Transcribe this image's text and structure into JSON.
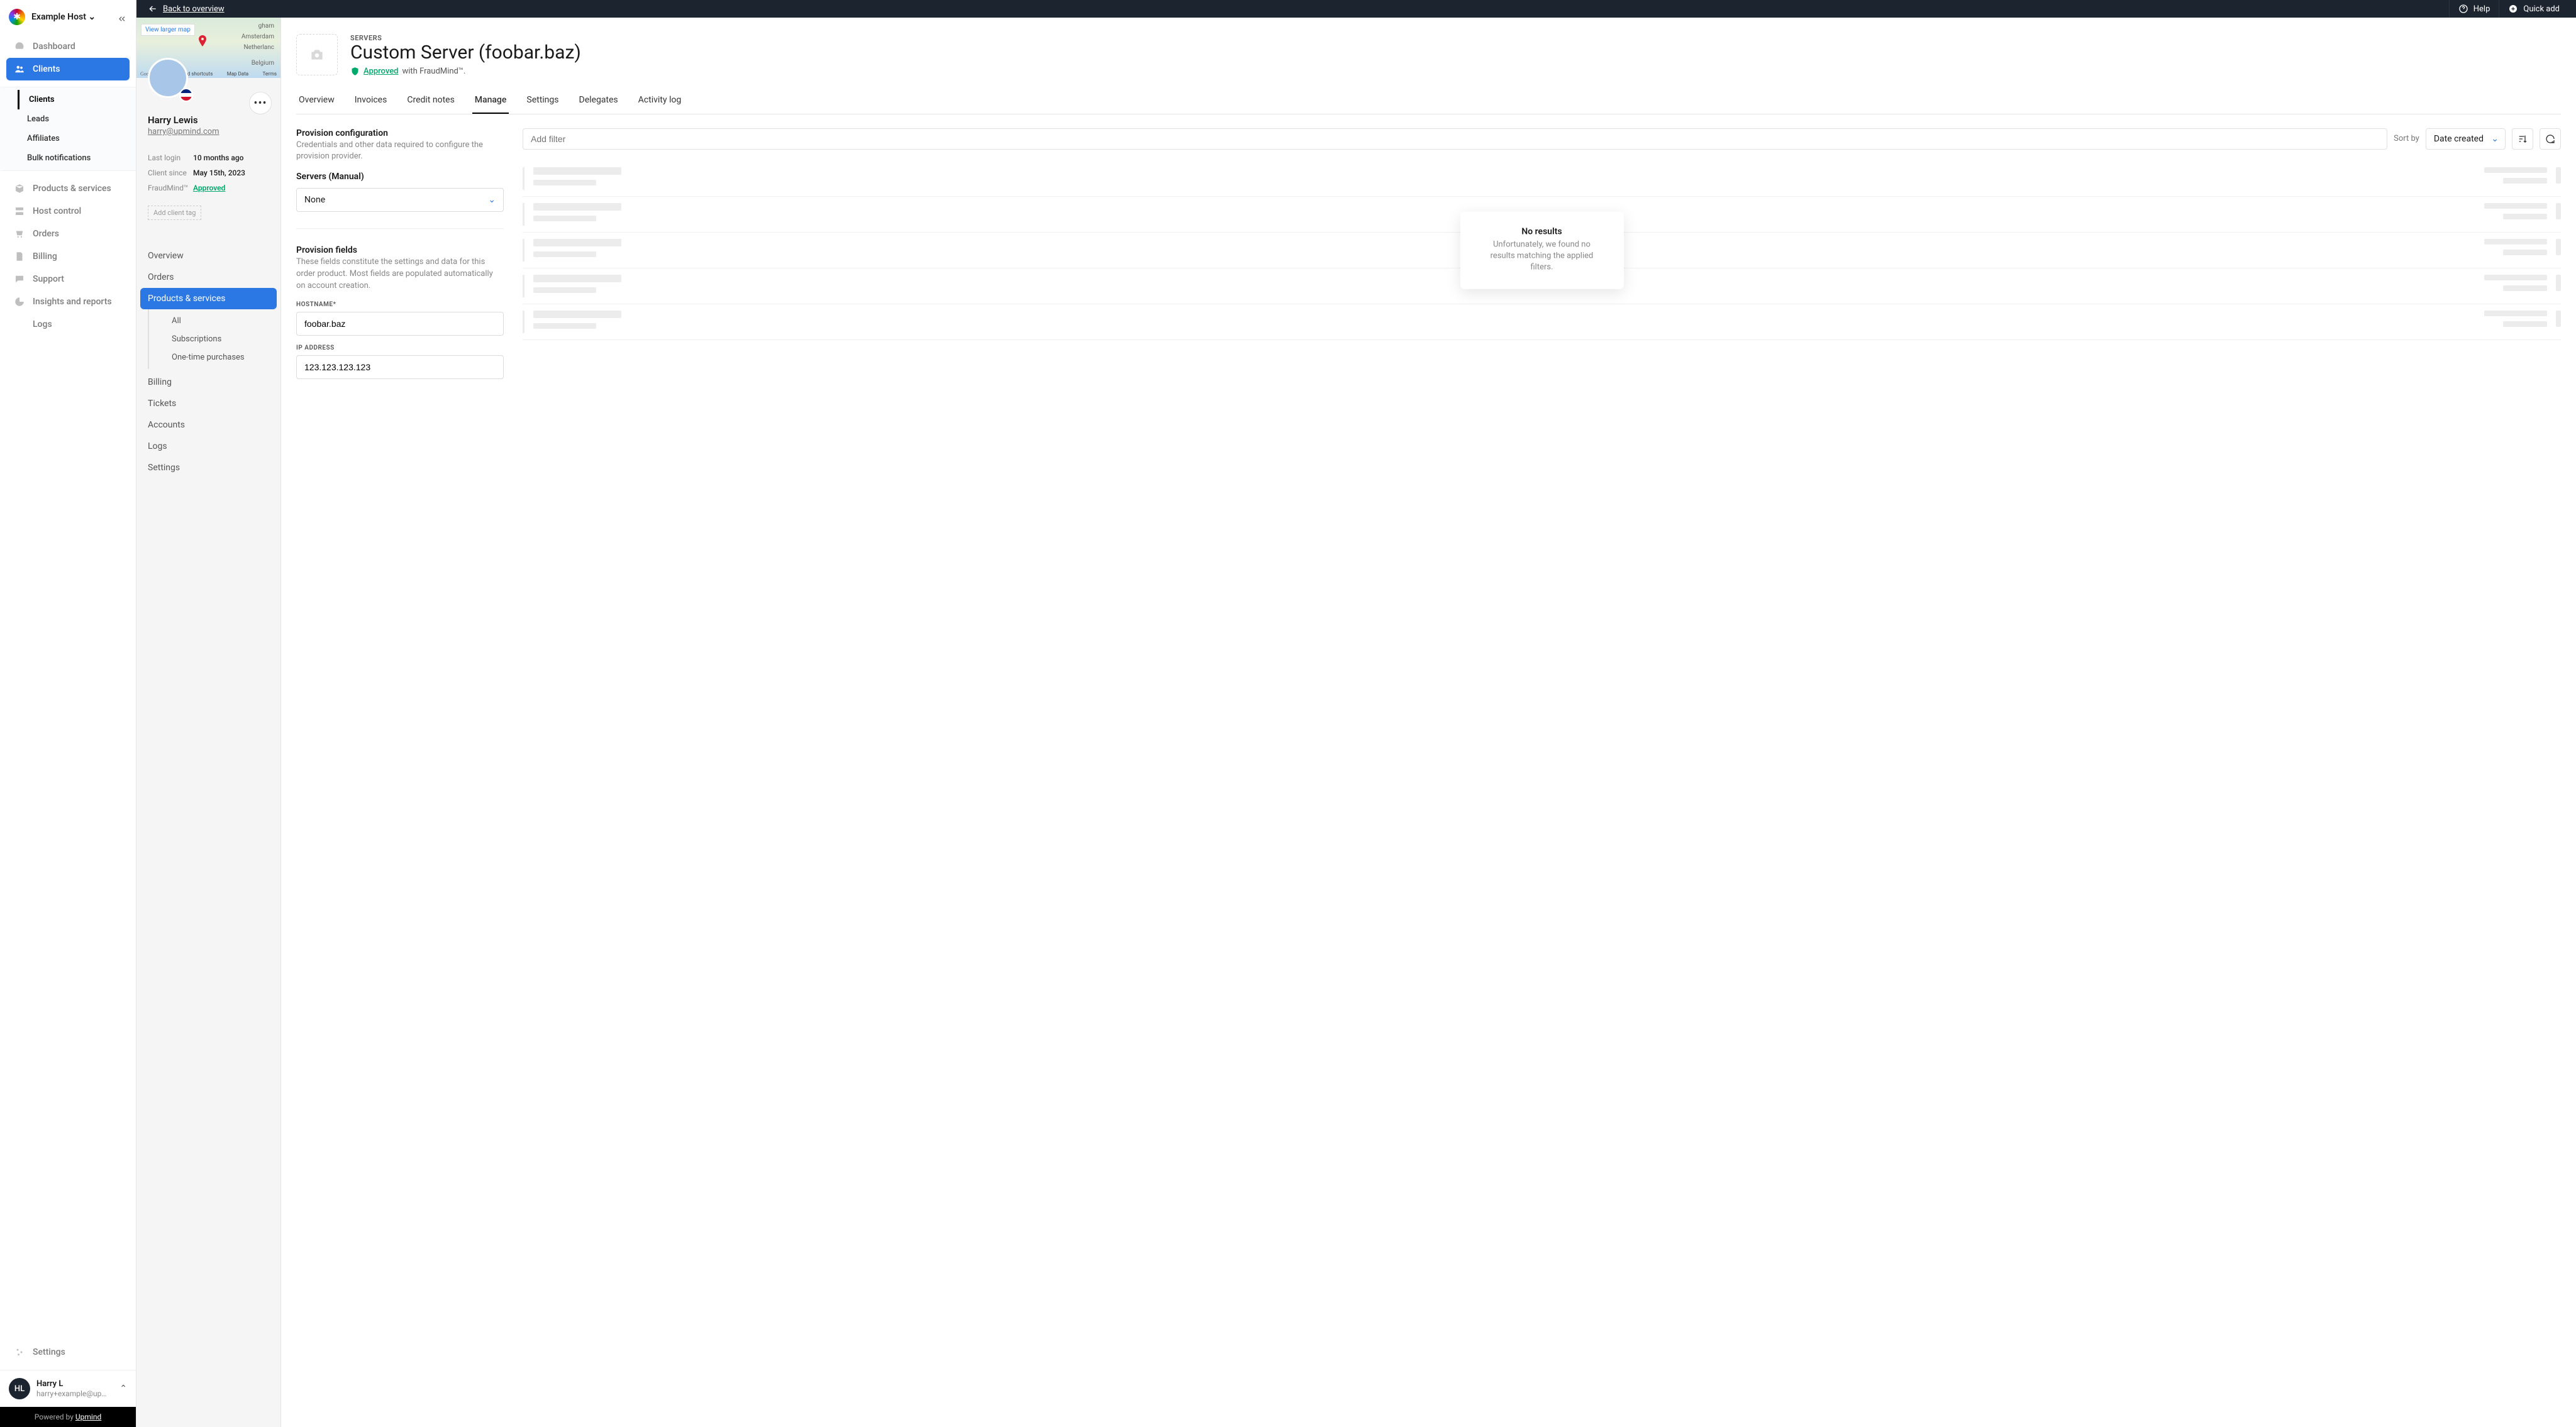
{
  "topbar": {
    "back": "Back to overview",
    "help": "Help",
    "quick_add": "Quick add"
  },
  "host_name": "Example Host",
  "nav": {
    "dashboard": "Dashboard",
    "clients": "Clients",
    "leads": "Leads",
    "affiliates": "Affiliates",
    "bulk": "Bulk notifications",
    "products": "Products & services",
    "hostctl": "Host control",
    "orders": "Orders",
    "billing": "Billing",
    "support": "Support",
    "insights": "Insights and reports",
    "logs": "Logs",
    "settings": "Settings"
  },
  "user_footer": {
    "initials": "HL",
    "name": "Harry L",
    "email": "harry+example@upmind....",
    "powered": "Powered by ",
    "brand": "Upmind"
  },
  "client": {
    "view_map": "View larger map",
    "map_labels": {
      "a": "gham",
      "b": "Amsterdam",
      "c": "Netherlanc",
      "d": "Belgium"
    },
    "map_foot": {
      "g": "Google",
      "ks": "Keyboard shortcuts",
      "md": "Map Data",
      "t": "Terms"
    },
    "name": "Harry Lewis",
    "email": "harry@upmind.com",
    "rows": {
      "last_login_lbl": "Last login",
      "last_login_val": "10 months ago",
      "since_lbl": "Client since",
      "since_val": "May 15th, 2023",
      "fraud_lbl": "FraudMind™",
      "fraud_val": "Approved"
    },
    "add_tag": "Add client tag",
    "nav": {
      "overview": "Overview",
      "orders": "Orders",
      "products": "Products & services",
      "all": "All",
      "subs": "Subscriptions",
      "one": "One-time purchases",
      "billing": "Billing",
      "tickets": "Tickets",
      "accounts": "Accounts",
      "logs": "Logs",
      "settings": "Settings"
    }
  },
  "page": {
    "crumb": "SERVERS",
    "title": "Custom Server (foobar.baz)",
    "approved": "Approved",
    "with": " with FraudMind™.",
    "tabs": {
      "overview": "Overview",
      "invoices": "Invoices",
      "credit": "Credit notes",
      "manage": "Manage",
      "settings": "Settings",
      "delegates": "Delegates",
      "activity": "Activity log"
    },
    "prov_h": "Provision configuration",
    "prov_p": "Credentials and other data required to configure the provision provider.",
    "servers_h": "Servers (Manual)",
    "none": "None",
    "fields_h": "Provision fields",
    "fields_p": "These fields constitute the settings and data for this order product. Most fields are populated automatically on account creation.",
    "hostname_lbl": "HOSTNAME*",
    "hostname_val": "foobar.baz",
    "ip_lbl": "IP ADDRESS",
    "ip_val": "123.123.123.123",
    "filter_ph": "Add filter",
    "sortby": "Sort by",
    "sort_val": "Date created",
    "no_results_t": "No results",
    "no_results_s": "Unfortunately, we found no results matching the applied filters."
  }
}
